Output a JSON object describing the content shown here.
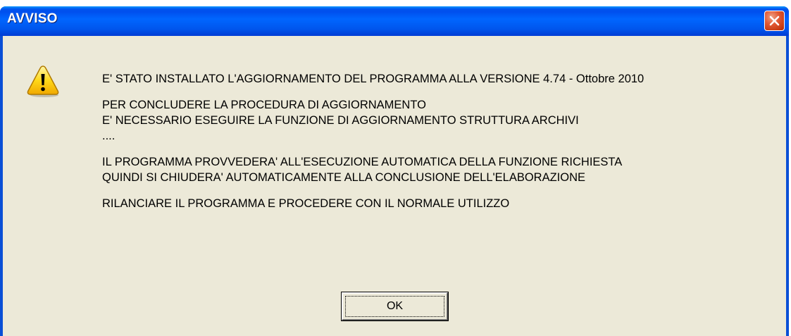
{
  "window": {
    "title": "AVVISO",
    "close_icon": "close-icon"
  },
  "dialog": {
    "icon": "warning-icon",
    "lines": [
      "E' STATO INSTALLATO L'AGGIORNAMENTO DEL PROGRAMMA ALLA VERSIONE 4.74 - Ottobre 2010",
      "PER CONCLUDERE LA PROCEDURA DI AGGIORNAMENTO",
      "E' NECESSARIO ESEGUIRE LA FUNZIONE DI AGGIORNAMENTO STRUTTURA ARCHIVI",
      "....",
      "IL PROGRAMMA PROVVEDERA' ALL'ESECUZIONE AUTOMATICA DELLA FUNZIONE RICHIESTA",
      "QUINDI SI CHIUDERA' AUTOMATICAMENTE ALLA CONCLUSIONE DELL'ELABORAZIONE",
      "RILANCIARE IL PROGRAMMA E PROCEDERE CON IL NORMALE UTILIZZO"
    ],
    "ok_label": "OK"
  },
  "colors": {
    "titlebar": "#0053ee",
    "client_bg": "#ece9d8",
    "close_button": "#e25a35"
  }
}
